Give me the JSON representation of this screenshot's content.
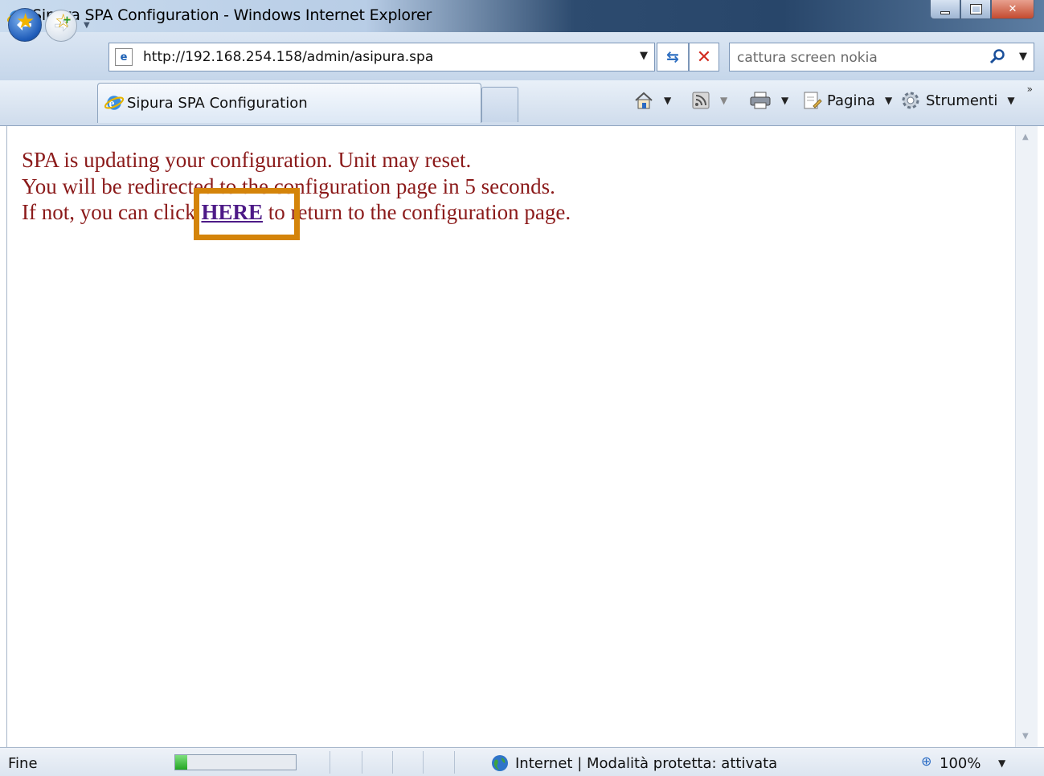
{
  "window": {
    "title": "Sipura SPA Configuration - Windows Internet Explorer"
  },
  "navigation": {
    "address": "http://192.168.254.158/admin/asipura.spa",
    "search_text": "cattura screen nokia"
  },
  "tab": {
    "label": "Sipura SPA Configuration"
  },
  "commands": {
    "page_label": "Pagina",
    "tools_label": "Strumenti"
  },
  "content": {
    "line1": "SPA is updating your configuration. Unit may reset.",
    "line2": "You will be redirected to the configuration page in 5 seconds.",
    "line3_prefix": "If not, you can click ",
    "link_text": "HERE",
    "line3_suffix": " to return to the configuration page."
  },
  "status": {
    "text": "Fine",
    "progress_fraction": 0.1,
    "zone": "Internet | Modalità protetta: attivata",
    "zoom": "100%"
  },
  "colors": {
    "content_text": "#8b1a1a",
    "link": "#4d1a87",
    "highlight": "#d4840a"
  }
}
